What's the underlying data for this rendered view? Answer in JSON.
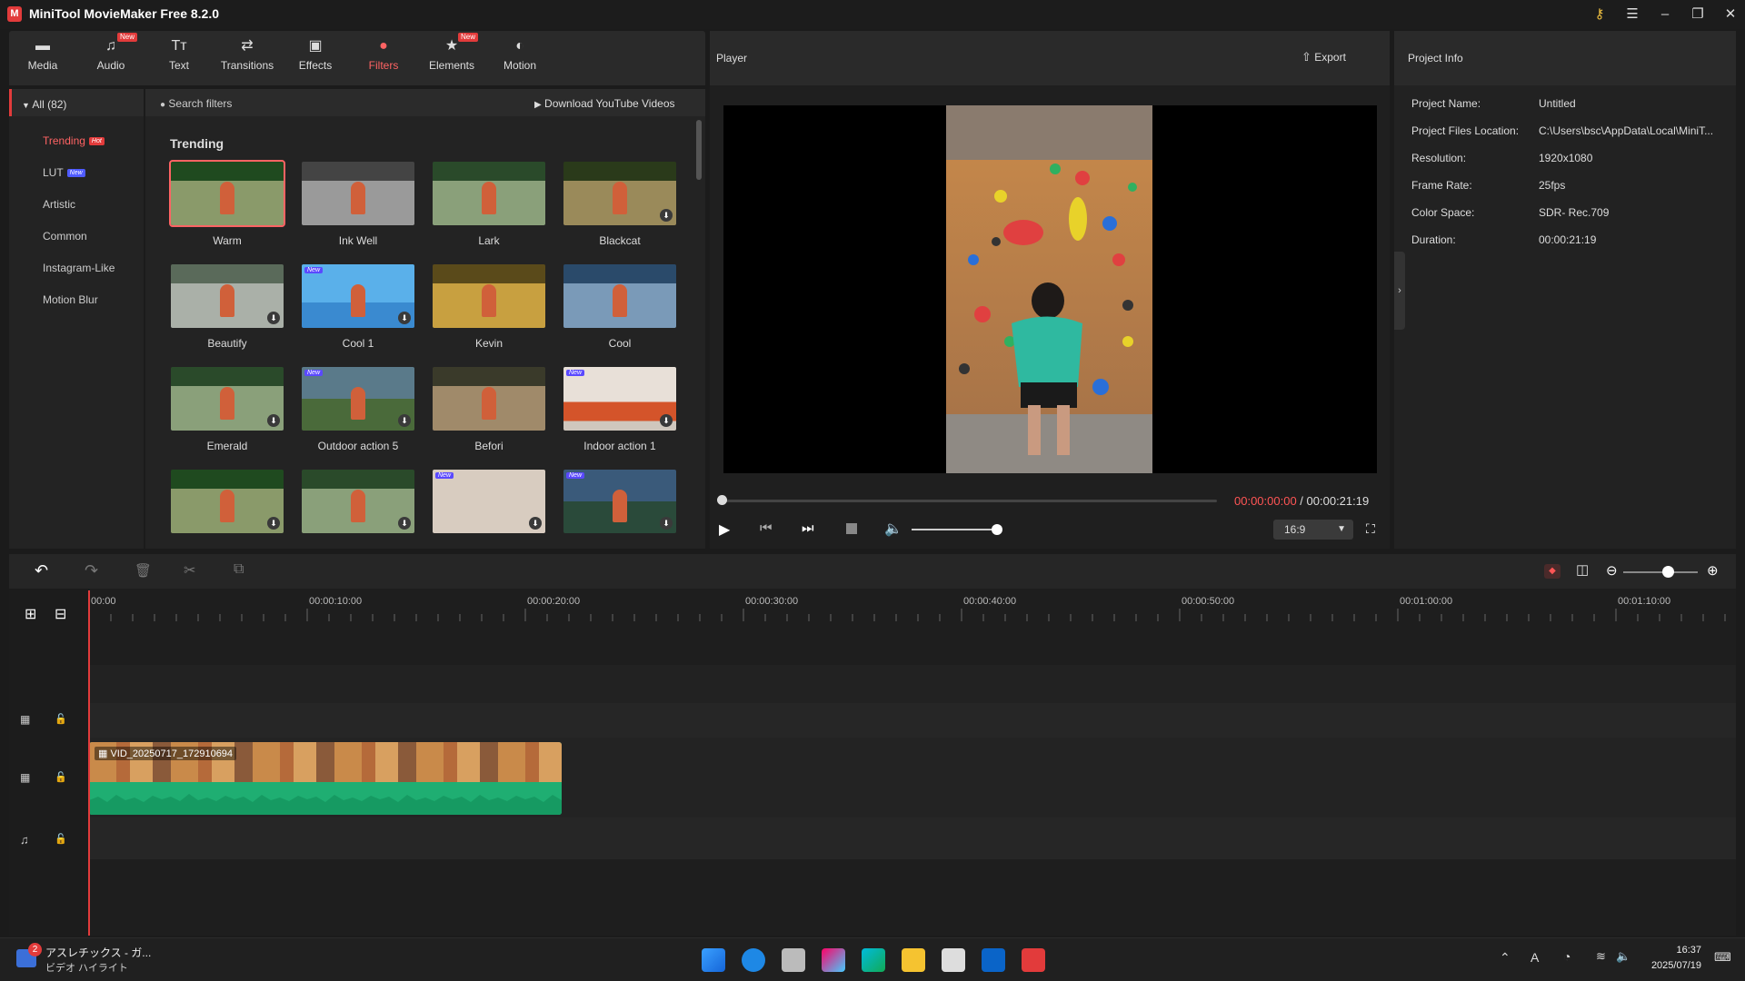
{
  "app": {
    "title": "MiniTool MovieMaker Free 8.2.0",
    "logo_letter": "M"
  },
  "tabs": [
    {
      "label": "Media",
      "icon": "folder-icon",
      "glyph": "▬",
      "new": false
    },
    {
      "label": "Audio",
      "icon": "music-note-icon",
      "glyph": "♫",
      "new": true
    },
    {
      "label": "Text",
      "icon": "text-icon",
      "glyph": "Tт",
      "new": false
    },
    {
      "label": "Transitions",
      "icon": "arrows-swap-icon",
      "glyph": "⇄",
      "new": false
    },
    {
      "label": "Effects",
      "icon": "effects-icon",
      "glyph": "▣",
      "new": false
    },
    {
      "label": "Filters",
      "icon": "filter-icon",
      "glyph": "●",
      "new": false,
      "active": true
    },
    {
      "label": "Elements",
      "icon": "elements-icon",
      "glyph": "★",
      "new": true
    },
    {
      "label": "Motion",
      "icon": "motion-icon",
      "glyph": "◐",
      "new": false
    }
  ],
  "new_badge": "New",
  "categories": {
    "all_label": "All (82)",
    "items": [
      {
        "label": "Trending",
        "badge": "Hot",
        "active": true
      },
      {
        "label": "LUT",
        "badge": "New"
      },
      {
        "label": "Artistic"
      },
      {
        "label": "Common"
      },
      {
        "label": "Instagram-Like"
      },
      {
        "label": "Motion Blur"
      }
    ]
  },
  "filters": {
    "search_placeholder": "Search filters",
    "download_link": "Download YouTube Videos",
    "section_title": "Trending",
    "items": [
      {
        "label": "Warm",
        "selected": true
      },
      {
        "label": "Ink Well"
      },
      {
        "label": "Lark"
      },
      {
        "label": "Blackcat",
        "download": true
      },
      {
        "label": "Beautify",
        "download": true
      },
      {
        "label": "Cool 1",
        "new": true,
        "download": true
      },
      {
        "label": "Kevin"
      },
      {
        "label": "Cool"
      },
      {
        "label": "Emerald",
        "download": true
      },
      {
        "label": "Outdoor action 5",
        "new": true,
        "download": true
      },
      {
        "label": "Befori"
      },
      {
        "label": "Indoor action 1",
        "new": true,
        "download": true
      },
      {
        "label": "",
        "download": true
      },
      {
        "label": "",
        "download": true
      },
      {
        "label": "",
        "new": true,
        "download": true
      },
      {
        "label": "",
        "new": true,
        "download": true
      }
    ]
  },
  "player": {
    "title": "Player",
    "export_label": "Export",
    "current_time": "00:00:00:00",
    "separator": " / ",
    "total_time": "00:00:21:19",
    "aspect_ratio": "16:9",
    "volume_level": 0.85,
    "progress": 0.0
  },
  "project_info": {
    "title": "Project Info",
    "rows": [
      {
        "label": "Project Name:",
        "value": "Untitled"
      },
      {
        "label": "Project Files Location:",
        "value": "C:\\Users\\bsc\\AppData\\Local\\MiniT..."
      },
      {
        "label": "Resolution:",
        "value": "1920x1080"
      },
      {
        "label": "Frame Rate:",
        "value": "25fps"
      },
      {
        "label": "Color Space:",
        "value": "SDR- Rec.709"
      },
      {
        "label": "Duration:",
        "value": "00:00:21:19"
      }
    ]
  },
  "timeline": {
    "ruler": [
      "00:00",
      "00:00:10:00",
      "00:00:20:00",
      "00:00:30:00",
      "00:00:40:00",
      "00:00:50:00",
      "00:01:00:00",
      "00:01:10:00"
    ],
    "clip_name": "VID_20250717_172910694",
    "zoom_level": 0.6
  },
  "taskbar": {
    "notification_title": "アスレチックス - ガ...",
    "notification_sub": "ビデオ ハイライト",
    "notification_count": "2",
    "time": "16:37",
    "date": "2025/07/19",
    "ime": "A"
  },
  "colors": {
    "accent": "#ff6363",
    "clip_audio": "#1fae72",
    "playhead": "#e23b3b"
  }
}
